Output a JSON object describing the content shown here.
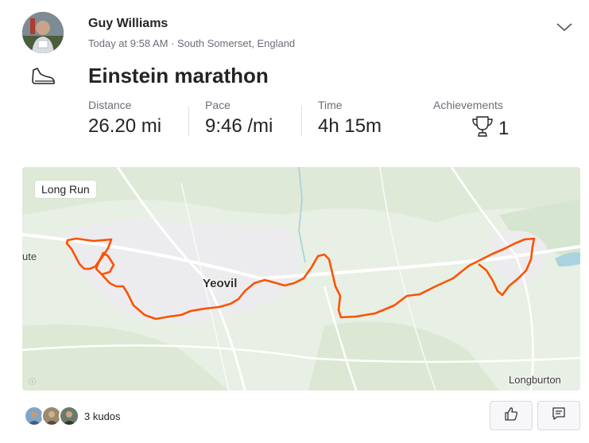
{
  "athlete": {
    "name": "Guy Williams",
    "meta": "Today at 9:58 AM · South Somerset, England"
  },
  "activity": {
    "title": "Einstein marathon",
    "type_icon": "shoe-icon"
  },
  "stats": {
    "distance": {
      "label": "Distance",
      "value": "26.20 mi"
    },
    "pace": {
      "label": "Pace",
      "value": "9:46 /mi"
    },
    "time": {
      "label": "Time",
      "value": "4h 15m"
    },
    "achievements": {
      "label": "Achievements",
      "value": "1",
      "icon": "trophy-icon"
    }
  },
  "map": {
    "badge": "Long Run",
    "places": {
      "yeovil": "Yeovil",
      "longburton": "Longburton",
      "left_edge": "ute"
    },
    "route_color": "#fc5200"
  },
  "kudos": {
    "text": "3 kudos"
  },
  "actions": {
    "kudos_icon": "thumbs-up-icon",
    "comment_icon": "comment-icon"
  },
  "colors": {
    "text": "#242428",
    "muted": "#6d6d78",
    "accent": "#fc5200"
  }
}
